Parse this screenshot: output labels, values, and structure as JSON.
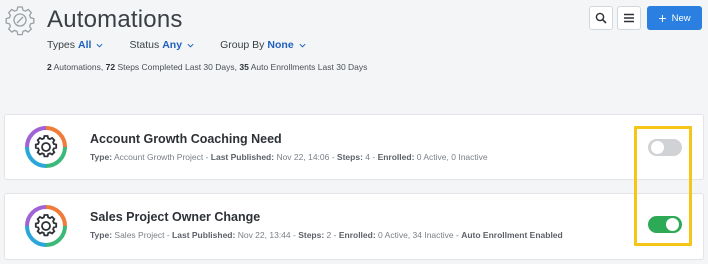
{
  "header": {
    "title": "Automations",
    "filters": [
      {
        "label": "Types",
        "value": "All"
      },
      {
        "label": "Status",
        "value": "Any"
      },
      {
        "label": "Group By",
        "value": "None"
      }
    ],
    "stats": {
      "automations": "2",
      "automations_label": " Automations, ",
      "steps": "72",
      "steps_label": " Steps Completed Last 30 Days, ",
      "enrollments": "35",
      "enrollments_label": " Auto Enrollments Last 30 Days"
    },
    "new_button_label": "New"
  },
  "automations": [
    {
      "name": "Account Growth Coaching Need",
      "type_label": "Type:",
      "type": " Account Growth Project - ",
      "published_label": "Last Published:",
      "published": " Nov 22, 14:06 - ",
      "steps_label": "Steps:",
      "steps": " 4 - ",
      "enrolled_label": "Enrolled:",
      "enrolled": " 0 Active, 0 Inactive",
      "extra": "",
      "enabled": false
    },
    {
      "name": "Sales Project Owner Change",
      "type_label": "Type:",
      "type": " Sales Project - ",
      "published_label": "Last Published:",
      "published": " Nov 22, 13:44 - ",
      "steps_label": "Steps:",
      "steps": " 2 - ",
      "enrolled_label": "Enrolled:",
      "enrolled": " 0 Active, 34 Inactive - ",
      "extra": "Auto Enrollment Enabled",
      "enabled": true
    }
  ],
  "colors": {
    "accent_blue": "#2a7fe0",
    "toggle_on": "#2eaa56",
    "toggle_off": "#d0d2d5",
    "highlight": "#f5c518"
  }
}
